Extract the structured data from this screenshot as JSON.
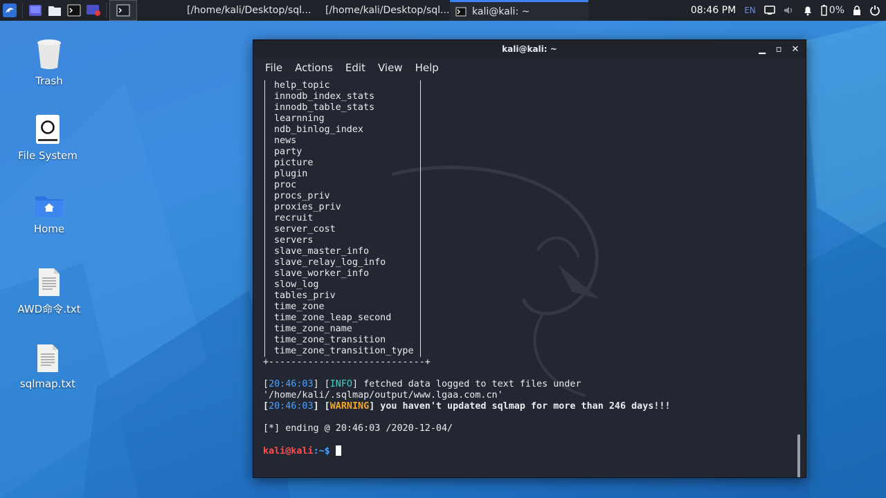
{
  "panel": {
    "tasks": [
      {
        "label": "[/home/kali/Desktop/sql..."
      },
      {
        "label": "[/home/kali/Desktop/sql..."
      },
      {
        "label": "kali@kali: ~"
      }
    ],
    "clock": "08:46 PM",
    "lang": "EN",
    "battery": "0%"
  },
  "desktop": {
    "icons": [
      {
        "label": "Trash"
      },
      {
        "label": "File System"
      },
      {
        "label": "Home"
      },
      {
        "label": "AWD命令.txt"
      },
      {
        "label": "sqlmap.txt"
      }
    ]
  },
  "window": {
    "title": "kali@kali: ~",
    "menu": [
      "File",
      "Actions",
      "Edit",
      "View",
      "Help"
    ]
  },
  "terminal": {
    "tables": [
      "help_topic",
      "innodb_index_stats",
      "innodb_table_stats",
      "learnning",
      "ndb_binlog_index",
      "news",
      "party",
      "picture",
      "plugin",
      "proc",
      "procs_priv",
      "proxies_priv",
      "recruit",
      "server_cost",
      "servers",
      "slave_master_info",
      "slave_relay_log_info",
      "slave_worker_info",
      "slow_log",
      "tables_priv",
      "time_zone",
      "time_zone_leap_second",
      "time_zone_name",
      "time_zone_transition",
      "time_zone_transition_type"
    ],
    "table_rule": "+----------------------------+",
    "log1_time": "20:46:03",
    "log1_tag": "INFO",
    "log1_text": " fetched data logged to text files under '/home/kali/.sqlmap/output/www.lgaa.com.cn'",
    "log2_time": "20:46:03",
    "log2_tag": "WARNING",
    "log2_text": " you haven't updated sqlmap for more than 246 days!!!",
    "ending": "[*] ending @ 20:46:03 /2020-12-04/",
    "prompt_user": "kali@kali",
    "prompt_path": ":~$"
  }
}
